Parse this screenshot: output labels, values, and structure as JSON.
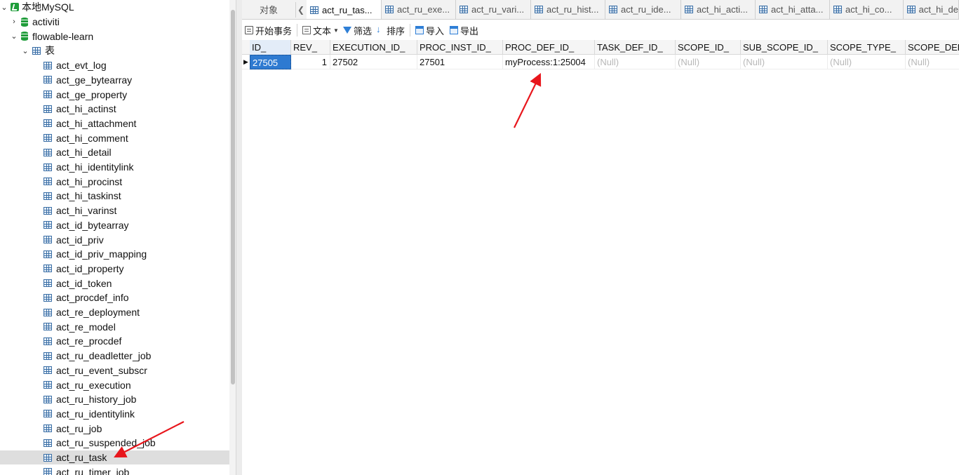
{
  "navigator": {
    "connection": {
      "label": "本地MySQL",
      "expanded": true
    },
    "databases": [
      {
        "label": "activiti",
        "expanded": false
      },
      {
        "label": "flowable-learn",
        "expanded": true
      }
    ],
    "tables_folder": {
      "label": "表",
      "expanded": true
    },
    "tables": [
      "act_evt_log",
      "act_ge_bytearray",
      "act_ge_property",
      "act_hi_actinst",
      "act_hi_attachment",
      "act_hi_comment",
      "act_hi_detail",
      "act_hi_identitylink",
      "act_hi_procinst",
      "act_hi_taskinst",
      "act_hi_varinst",
      "act_id_bytearray",
      "act_id_priv",
      "act_id_priv_mapping",
      "act_id_property",
      "act_id_token",
      "act_procdef_info",
      "act_re_deployment",
      "act_re_model",
      "act_re_procdef",
      "act_ru_deadletter_job",
      "act_ru_event_subscr",
      "act_ru_execution",
      "act_ru_history_job",
      "act_ru_identitylink",
      "act_ru_job",
      "act_ru_suspended_job",
      "act_ru_task",
      "act_ru_timer_job"
    ],
    "selected_table": "act_ru_task"
  },
  "tabs": {
    "objects_label": "对象",
    "items": [
      {
        "label": "act_ru_tas...",
        "active": true
      },
      {
        "label": "act_ru_exe...",
        "active": false
      },
      {
        "label": "act_ru_vari...",
        "active": false
      },
      {
        "label": "act_ru_hist...",
        "active": false
      },
      {
        "label": "act_ru_ide...",
        "active": false
      },
      {
        "label": "act_hi_acti...",
        "active": false
      },
      {
        "label": "act_hi_atta...",
        "active": false
      },
      {
        "label": "act_hi_co...",
        "active": false
      },
      {
        "label": "act_hi_de",
        "active": false
      }
    ]
  },
  "toolbar": {
    "begin_transaction": "开始事务",
    "text": "文本",
    "filter": "筛选",
    "sort": "排序",
    "import": "导入",
    "export": "导出"
  },
  "grid": {
    "columns": [
      "ID_",
      "REV_",
      "EXECUTION_ID_",
      "PROC_INST_ID_",
      "PROC_DEF_ID_",
      "TASK_DEF_ID_",
      "SCOPE_ID_",
      "SUB_SCOPE_ID_",
      "SCOPE_TYPE_",
      "SCOPE_DEFI"
    ],
    "rows": [
      [
        "27505",
        "1",
        "27502",
        "27501",
        "myProcess:1:25004",
        "(Null)",
        "(Null)",
        "(Null)",
        "(Null)",
        "(Null)"
      ]
    ]
  },
  "colors": {
    "selection": "#2e7ad1",
    "null_text": "#b8b8b8",
    "annotation_arrow": "#e8161c",
    "db_icon": "#1f9d3a"
  }
}
